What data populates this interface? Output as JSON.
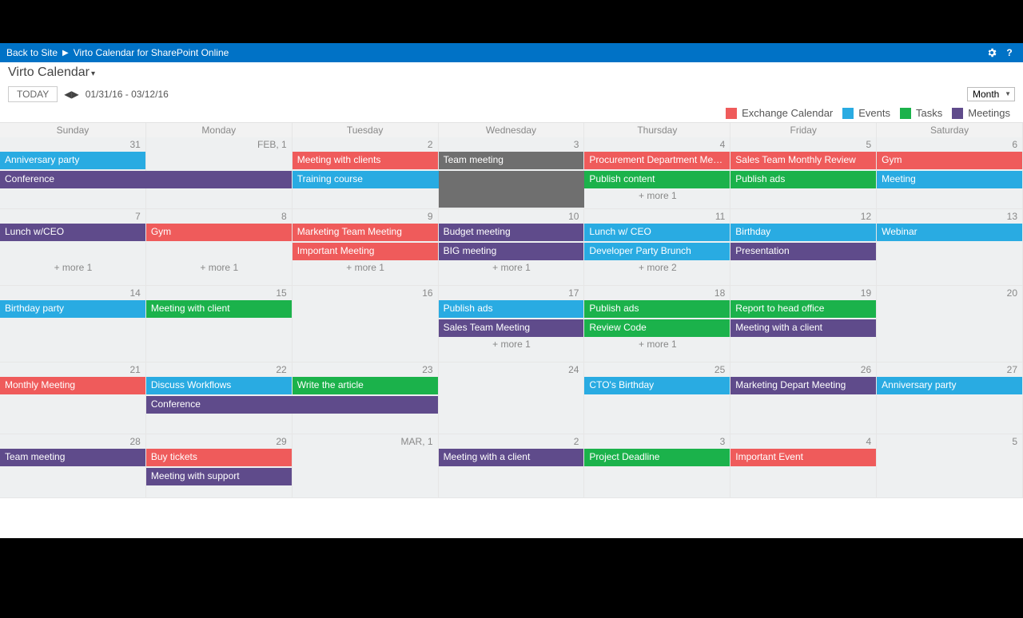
{
  "suitebar": {
    "back": "Back to Site",
    "crumb": "Virto Calendar for SharePoint Online"
  },
  "app_title": "Virto Calendar",
  "toolbar": {
    "today": "TODAY",
    "range": "01/31/16 - 03/12/16",
    "view": "Month"
  },
  "legend": [
    {
      "label": "Exchange Calendar",
      "color": "#ef5b5b"
    },
    {
      "label": "Events",
      "color": "#29abe2"
    },
    {
      "label": "Tasks",
      "color": "#1bb24b"
    },
    {
      "label": "Meetings",
      "color": "#5f4b8b"
    }
  ],
  "dayheads": [
    "Sunday",
    "Monday",
    "Tuesday",
    "Wednesday",
    "Thursday",
    "Friday",
    "Saturday"
  ],
  "daynums": [
    [
      "31",
      "FEB, 1",
      "2",
      "3",
      "4",
      "5",
      "6"
    ],
    [
      "7",
      "8",
      "9",
      "10",
      "11",
      "12",
      "13"
    ],
    [
      "14",
      "15",
      "16",
      "17",
      "18",
      "19",
      "20"
    ],
    [
      "21",
      "22",
      "23",
      "24",
      "25",
      "26",
      "27"
    ],
    [
      "28",
      "29",
      "MAR, 1",
      "2",
      "3",
      "4",
      "5"
    ]
  ],
  "weeks": [
    {
      "rows": [
        [
          {
            "text": "Anniversary party",
            "cls": "c-blue",
            "start": 0,
            "span": 1
          },
          {
            "gap": 1
          },
          {
            "text": "Meeting with clients",
            "cls": "c-red",
            "start": 2,
            "span": 1
          },
          {
            "text": "Team meeting",
            "cls": "c-grey",
            "start": 3,
            "span": 1
          },
          {
            "text": "Procurement Department Meeting",
            "cls": "c-red",
            "start": 4,
            "span": 1
          },
          {
            "text": "Sales Team Monthly Review",
            "cls": "c-red",
            "start": 5,
            "span": 1
          },
          {
            "text": "Gym",
            "cls": "c-red",
            "start": 6,
            "span": 1
          }
        ],
        [
          {
            "text": "Conference",
            "cls": "c-purple",
            "start": 0,
            "span": 2
          },
          {
            "text": "Training course",
            "cls": "c-blue",
            "start": 2,
            "span": 2
          },
          {
            "text": "Publish content",
            "cls": "c-green",
            "start": 4,
            "span": 1
          },
          {
            "text": "Publish ads",
            "cls": "c-green",
            "start": 5,
            "span": 1
          },
          {
            "text": "Meeting",
            "cls": "c-blue",
            "start": 6,
            "span": 1
          }
        ]
      ],
      "more": {
        "4": "+ more 1"
      }
    },
    {
      "rows": [
        [
          {
            "text": "Lunch w/CEO",
            "cls": "c-purple",
            "start": 0,
            "span": 1
          },
          {
            "text": "Gym",
            "cls": "c-red",
            "start": 1,
            "span": 1
          },
          {
            "text": "Marketing Team Meeting",
            "cls": "c-red",
            "start": 2,
            "span": 1
          },
          {
            "text": "Budget meeting",
            "cls": "c-purple",
            "start": 3,
            "span": 1
          },
          {
            "text": "Lunch w/ CEO",
            "cls": "c-blue",
            "start": 4,
            "span": 1
          },
          {
            "text": "Birthday",
            "cls": "c-blue",
            "start": 5,
            "span": 1
          },
          {
            "text": "Webinar",
            "cls": "c-blue",
            "start": 6,
            "span": 1
          }
        ],
        [
          {
            "gap": 2
          },
          {
            "text": "Important Meeting",
            "cls": "c-red",
            "start": 2,
            "span": 1
          },
          {
            "text": "BIG meeting",
            "cls": "c-purple",
            "start": 3,
            "span": 1
          },
          {
            "text": "Developer Party Brunch",
            "cls": "c-blue",
            "start": 4,
            "span": 1
          },
          {
            "text": "Presentation",
            "cls": "c-purple",
            "start": 5,
            "span": 1
          },
          {
            "gap": 1
          }
        ]
      ],
      "more": {
        "0": "+ more 1",
        "1": "+ more 1",
        "2": "+ more 1",
        "3": "+ more 1",
        "4": "+ more 2"
      }
    },
    {
      "rows": [
        [
          {
            "text": "Birthday party",
            "cls": "c-blue",
            "start": 0,
            "span": 1
          },
          {
            "text": "Meeting with client",
            "cls": "c-green",
            "start": 1,
            "span": 1
          },
          {
            "gap": 1
          },
          {
            "text": "Publish ads",
            "cls": "c-blue",
            "start": 3,
            "span": 1
          },
          {
            "text": "Publish ads",
            "cls": "c-green",
            "start": 4,
            "span": 1
          },
          {
            "text": "Report to head office",
            "cls": "c-green",
            "start": 5,
            "span": 1
          },
          {
            "gap": 1
          }
        ],
        [
          {
            "gap": 3
          },
          {
            "text": "Sales Team Meeting",
            "cls": "c-purple",
            "start": 3,
            "span": 1
          },
          {
            "text": "Review Code",
            "cls": "c-green",
            "start": 4,
            "span": 1
          },
          {
            "text": "Meeting with a client",
            "cls": "c-purple",
            "start": 5,
            "span": 1
          },
          {
            "gap": 1
          }
        ]
      ],
      "more": {
        "3": "+ more 1",
        "4": "+ more 1"
      }
    },
    {
      "rows": [
        [
          {
            "text": "Monthly Meeting",
            "cls": "c-red",
            "start": 0,
            "span": 1
          },
          {
            "text": "Discuss Workflows",
            "cls": "c-blue",
            "start": 1,
            "span": 1
          },
          {
            "text": "Write the article",
            "cls": "c-green",
            "start": 2,
            "span": 1
          },
          {
            "gap": 1
          },
          {
            "text": "CTO's Birthday",
            "cls": "c-blue",
            "start": 4,
            "span": 1
          },
          {
            "text": "Marketing Depart Meeting",
            "cls": "c-purple",
            "start": 5,
            "span": 1
          },
          {
            "text": "Anniversary party",
            "cls": "c-blue",
            "start": 6,
            "span": 1
          }
        ],
        [
          {
            "gap": 1
          },
          {
            "text": "Conference",
            "cls": "c-purple",
            "start": 1,
            "span": 2
          },
          {
            "gap": 4
          }
        ]
      ],
      "more": {}
    },
    {
      "rows": [
        [
          {
            "text": "Team meeting",
            "cls": "c-purple",
            "start": 0,
            "span": 1
          },
          {
            "text": "Buy tickets",
            "cls": "c-red",
            "start": 1,
            "span": 1
          },
          {
            "gap": 1
          },
          {
            "text": "Meeting with a client",
            "cls": "c-purple",
            "start": 3,
            "span": 1
          },
          {
            "text": "Project Deadline",
            "cls": "c-green",
            "start": 4,
            "span": 1
          },
          {
            "text": "Important Event",
            "cls": "c-red",
            "start": 5,
            "span": 1
          },
          {
            "gap": 1
          }
        ],
        [
          {
            "gap": 1
          },
          {
            "text": "Meeting with support",
            "cls": "c-purple",
            "start": 1,
            "span": 1
          },
          {
            "gap": 5
          }
        ]
      ],
      "more": {}
    }
  ]
}
